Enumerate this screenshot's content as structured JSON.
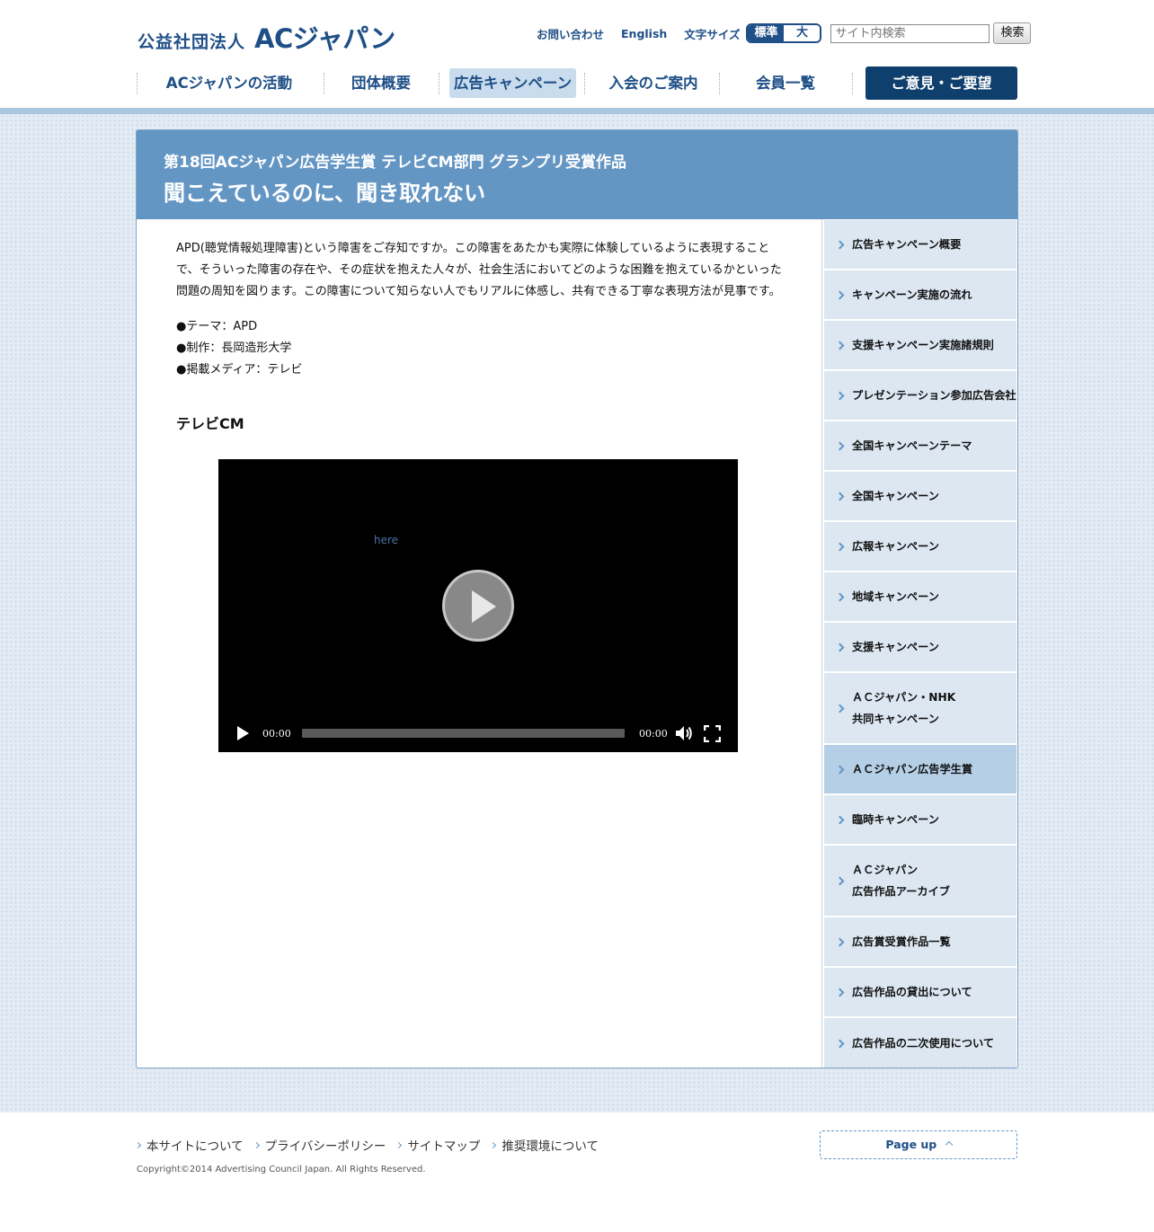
{
  "header": {
    "logo_org": "公益社団法人",
    "logo_name": "ACジャパン",
    "util_links": [
      "お問い合わせ",
      "English"
    ],
    "font_size_label": "文字サイズ",
    "font_size_options": [
      "標準",
      "大"
    ],
    "font_size_selected": "標準",
    "search_placeholder": "サイト内検索",
    "search_button": "検索"
  },
  "gnav": {
    "items": [
      "ACジャパンの活動",
      "団体概要",
      "広告キャンペーン",
      "入会のご案内",
      "会員一覧"
    ],
    "current": "広告キャンペーン",
    "opinion_button": "ご意見・ご要望"
  },
  "page": {
    "subtitle": "第18回ACジャパン広告学生賞 テレビCM部門 グランプリ受賞作品",
    "title": "聞こえているのに、聞き取れない",
    "lead": "APD(聴覚情報処理障害)という障害をご存知ですか。この障害をあたかも実際に体験しているように表現することで、そういった障害の存在や、その症状を抱えた人々が、社会生活においてどのような困難を抱えているかといった問題の周知を図ります。この障害について知らない人でもリアルに体感し、共有できる丁寧な表現方法が見事です。",
    "specs": [
      "●テーマ：APD",
      "●制作：長岡造形大学",
      "●掲載メディア：テレビ"
    ],
    "section_heading": "テレビCM"
  },
  "video": {
    "link_text": "here",
    "current_time": "00:00",
    "duration": "00:00",
    "progress": 0
  },
  "sidebar": {
    "items": [
      {
        "label": "広告キャンペーン概要"
      },
      {
        "label": "キャンペーン実施の流れ"
      },
      {
        "label": "支援キャンペーン実施諸規則"
      },
      {
        "label": "プレゼンテーション参加広告会社"
      },
      {
        "label": "全国キャンペーンテーマ"
      },
      {
        "label": "全国キャンペーン"
      },
      {
        "label": "広報キャンペーン"
      },
      {
        "label": "地域キャンペーン"
      },
      {
        "label": "支援キャンペーン"
      },
      {
        "label": "ＡＣジャパン・NHK",
        "label2": "共同キャンペーン"
      },
      {
        "label": "ＡＣジャパン広告学生賞"
      },
      {
        "label": "臨時キャンペーン"
      },
      {
        "label": "ＡＣジャパン",
        "label2": "広告作品アーカイブ"
      },
      {
        "label": "広告賞受賞作品一覧"
      },
      {
        "label": "広告作品の貸出について"
      },
      {
        "label": "広告作品の二次使用について"
      }
    ],
    "current": "ＡＣジャパン広告学生賞"
  },
  "footer": {
    "links": [
      "本サイトについて",
      "プライバシーポリシー",
      "サイトマップ",
      "推奨環境について"
    ],
    "copyright": "Copyright©2014 Advertising Council Japan. All Rights Reserved.",
    "pageup": "Page up"
  },
  "colors": {
    "brand_navy": "#1f4f87",
    "title_band": "#6496c4",
    "sidebar_bg": "#dce7f2",
    "sidebar_current": "#b5cfe6",
    "opinion_button": "#0f3f6c"
  }
}
